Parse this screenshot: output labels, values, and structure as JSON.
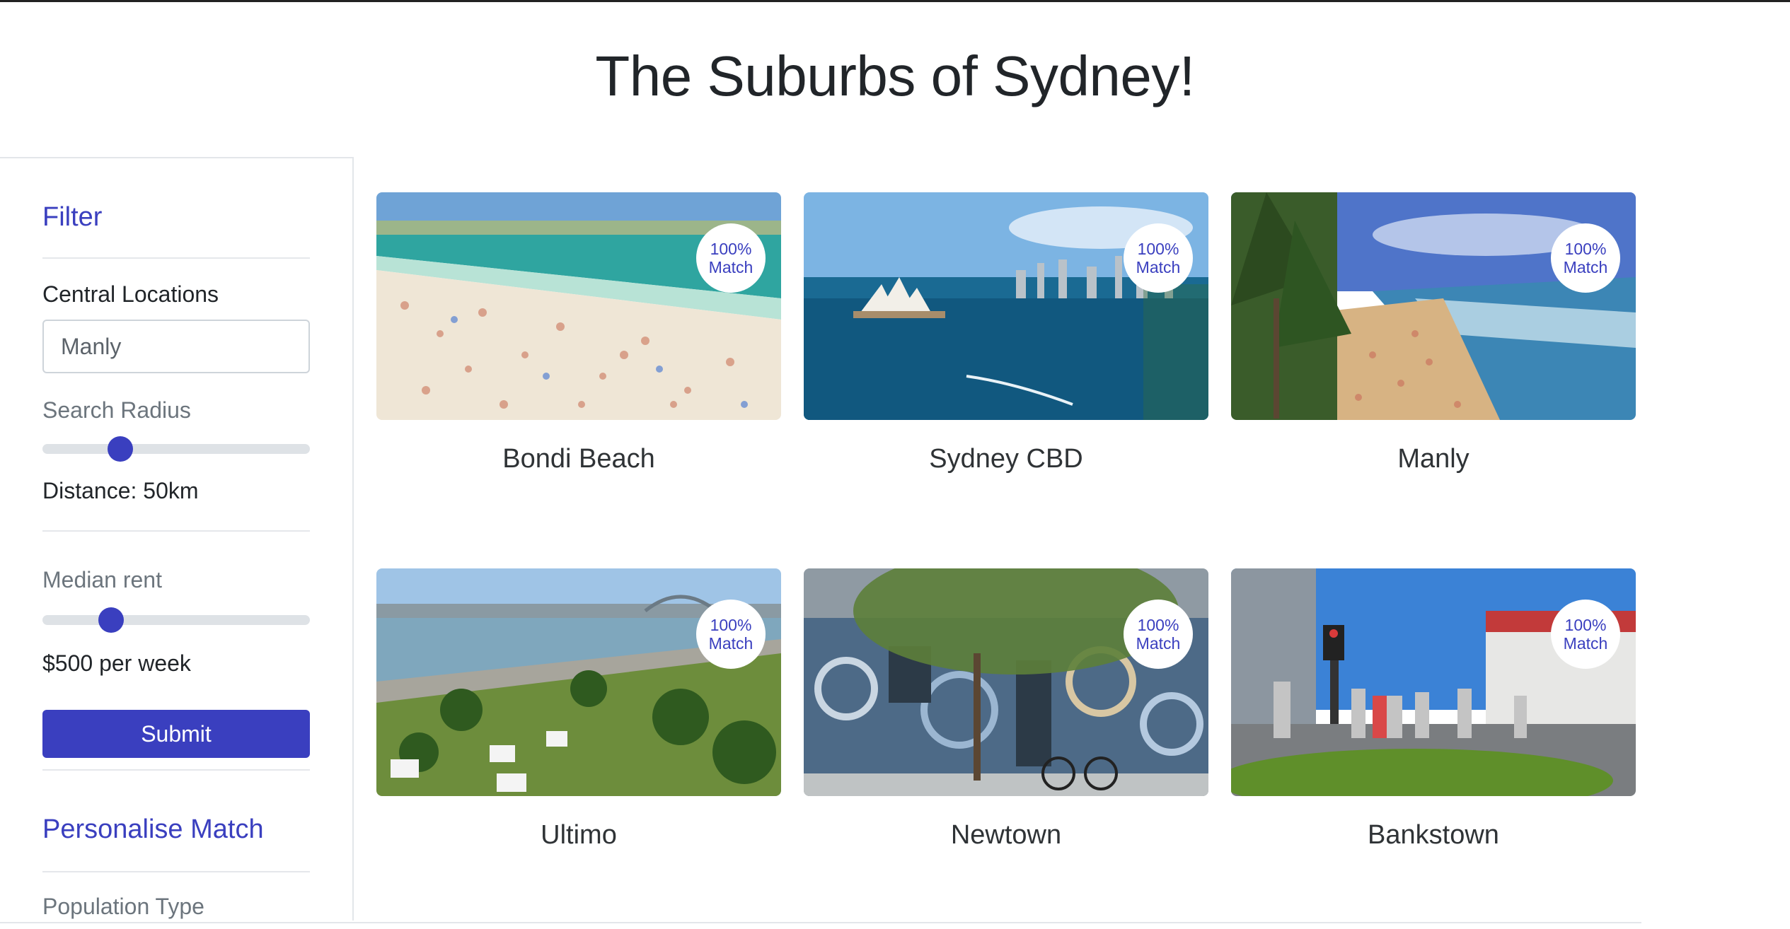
{
  "page": {
    "title": "The Suburbs of Sydney!"
  },
  "sidebar": {
    "filter_heading": "Filter",
    "central_locations_label": "Central Locations",
    "central_locations_value": "Manly",
    "search_radius_label": "Search Radius",
    "search_radius_fraction": 0.27,
    "distance_text": "Distance: 50km",
    "median_rent_label": "Median rent",
    "median_rent_fraction": 0.23,
    "rent_text": "$500 per week",
    "submit_label": "Submit",
    "personalise_heading": "Personalise Match",
    "population_type_label": "Population Type"
  },
  "cards": [
    {
      "name": "Bondi Beach",
      "match_percent": "100%",
      "match_label": "Match"
    },
    {
      "name": "Sydney CBD",
      "match_percent": "100%",
      "match_label": "Match"
    },
    {
      "name": "Manly",
      "match_percent": "100%",
      "match_label": "Match"
    },
    {
      "name": "Ultimo",
      "match_percent": "100%",
      "match_label": "Match"
    },
    {
      "name": "Newtown",
      "match_percent": "100%",
      "match_label": "Match"
    },
    {
      "name": "Bankstown",
      "match_percent": "100%",
      "match_label": "Match"
    }
  ],
  "colors": {
    "accent": "#3a3fbf",
    "text": "#212529",
    "muted": "#6c757d"
  }
}
